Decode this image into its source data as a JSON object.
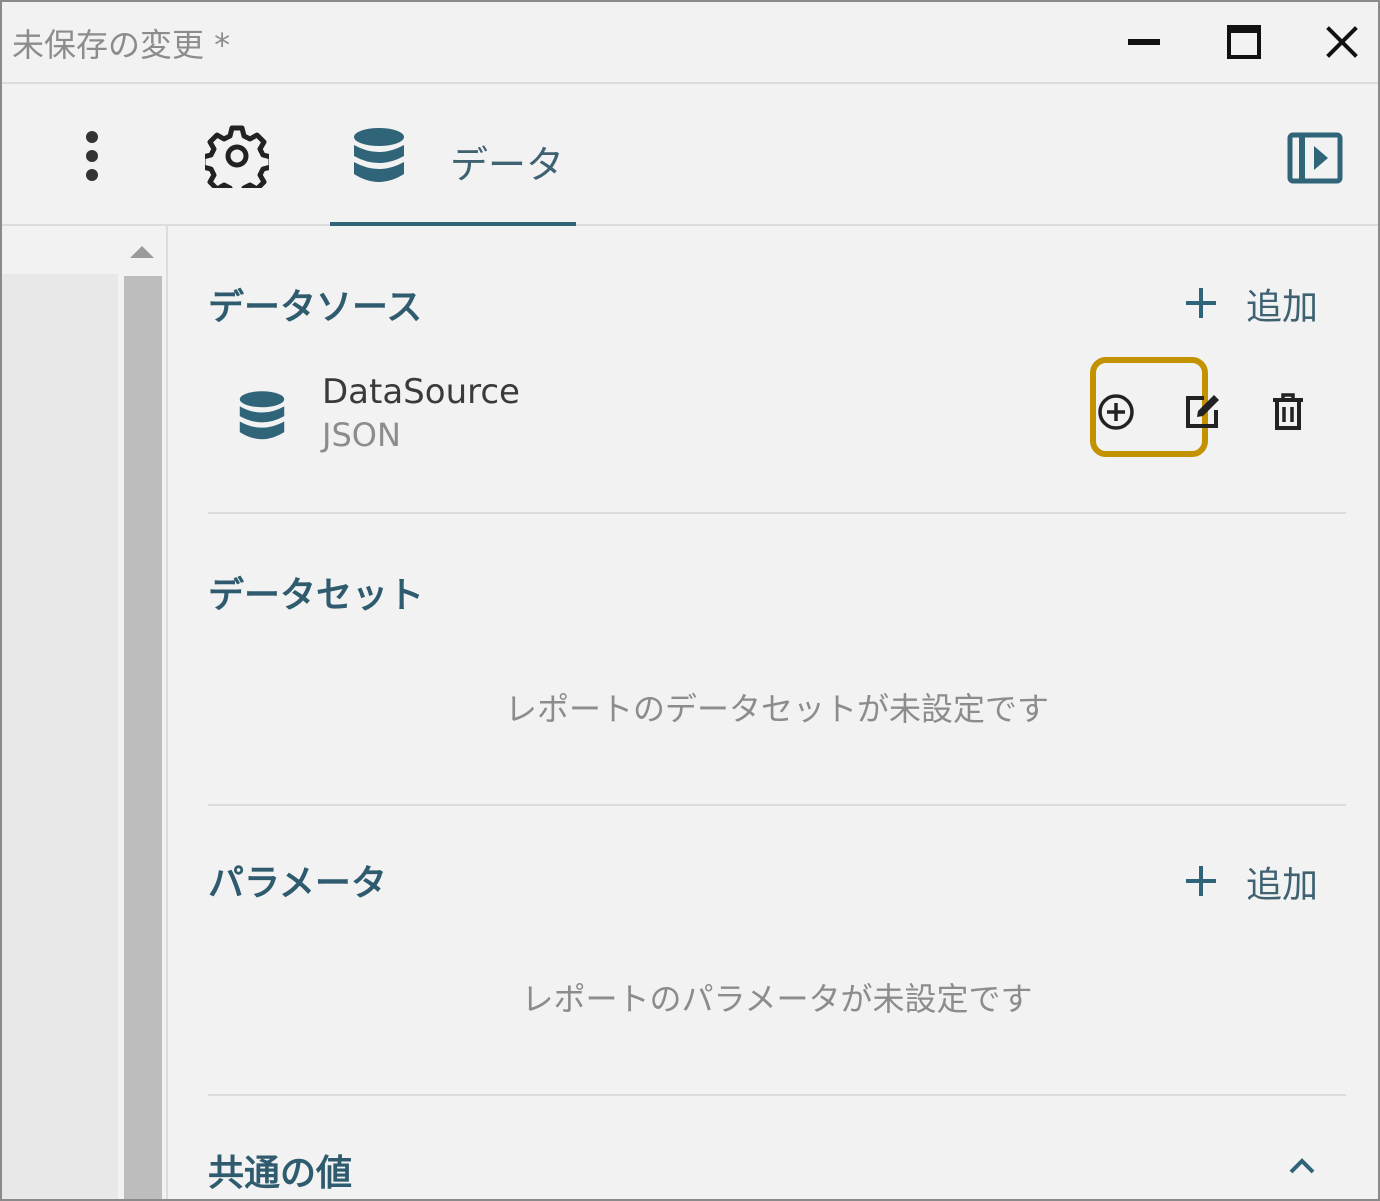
{
  "window": {
    "title": "未保存の変更 *"
  },
  "toolbar": {
    "tab_data_label": "データ"
  },
  "data_sources": {
    "title": "データソース",
    "add_label": "追加",
    "items": [
      {
        "name": "DataSource",
        "type": "JSON"
      }
    ]
  },
  "data_sets": {
    "title": "データセット",
    "empty_message": "レポートのデータセットが未設定です"
  },
  "parameters": {
    "title": "パラメータ",
    "add_label": "追加",
    "empty_message": "レポートのパラメータが未設定です"
  },
  "common_values": {
    "title": "共通の値"
  },
  "colors": {
    "accent": "#2f6479",
    "highlight": "#c29200",
    "heading": "#2f5b6e"
  },
  "icons": {
    "minimize": "minimize-icon",
    "maximize": "maximize-icon",
    "close": "close-icon",
    "menu": "kebab-menu-icon",
    "settings": "gear-icon",
    "database": "database-icon",
    "panel": "panel-toggle-icon",
    "add": "plus-icon",
    "add_circle": "add-circle-icon",
    "edit": "edit-icon",
    "delete": "trash-icon",
    "collapse": "chevron-up-icon"
  }
}
